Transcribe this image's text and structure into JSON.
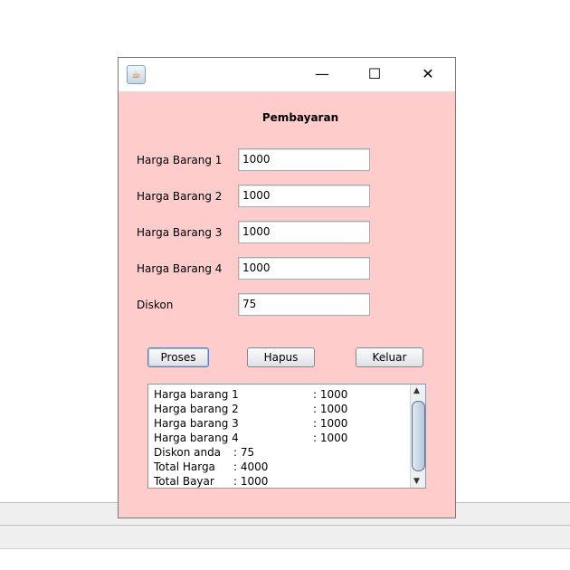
{
  "window": {
    "title_icon": "java-cup-icon",
    "minimize": "—",
    "maximize": "☐",
    "close": "✕",
    "bg": "#ffcccc"
  },
  "heading": "Pembayaran",
  "fields": [
    {
      "label": "Harga Barang 1",
      "value": "1000"
    },
    {
      "label": "Harga Barang 2",
      "value": "1000"
    },
    {
      "label": "Harga Barang 3",
      "value": "1000"
    },
    {
      "label": "Harga Barang 4",
      "value": "1000"
    },
    {
      "label": "Diskon",
      "value": "75"
    }
  ],
  "buttons": {
    "proses": "Proses",
    "hapus": "Hapus",
    "keluar": "Keluar"
  },
  "output": [
    {
      "label": "Harga barang 1",
      "value": ": 1000"
    },
    {
      "label": "Harga barang 2",
      "value": ": 1000"
    },
    {
      "label": "Harga barang 3",
      "value": ": 1000"
    },
    {
      "label": "Harga barang 4",
      "value": ": 1000"
    },
    {
      "label": "Diskon anda",
      "value": ": 75"
    },
    {
      "label": "Total Harga",
      "value": ": 4000"
    },
    {
      "label": "Total Bayar",
      "value": ": 1000"
    }
  ]
}
